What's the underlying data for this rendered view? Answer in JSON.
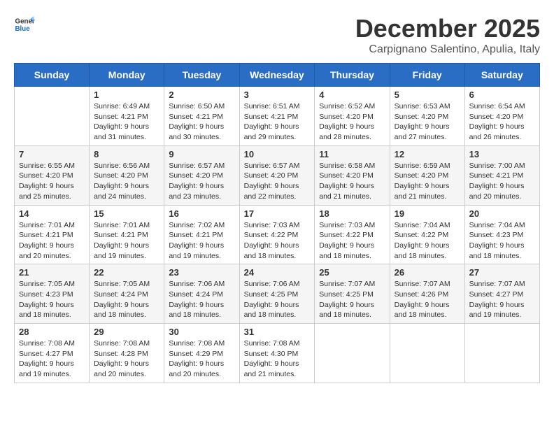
{
  "header": {
    "logo": {
      "general": "General",
      "blue": "Blue"
    },
    "title": "December 2025",
    "location": "Carpignano Salentino, Apulia, Italy"
  },
  "weekdays": [
    "Sunday",
    "Monday",
    "Tuesday",
    "Wednesday",
    "Thursday",
    "Friday",
    "Saturday"
  ],
  "weeks": [
    [
      {
        "day": "",
        "sunrise": "",
        "sunset": "",
        "daylight": ""
      },
      {
        "day": "1",
        "sunrise": "Sunrise: 6:49 AM",
        "sunset": "Sunset: 4:21 PM",
        "daylight": "Daylight: 9 hours and 31 minutes."
      },
      {
        "day": "2",
        "sunrise": "Sunrise: 6:50 AM",
        "sunset": "Sunset: 4:21 PM",
        "daylight": "Daylight: 9 hours and 30 minutes."
      },
      {
        "day": "3",
        "sunrise": "Sunrise: 6:51 AM",
        "sunset": "Sunset: 4:21 PM",
        "daylight": "Daylight: 9 hours and 29 minutes."
      },
      {
        "day": "4",
        "sunrise": "Sunrise: 6:52 AM",
        "sunset": "Sunset: 4:20 PM",
        "daylight": "Daylight: 9 hours and 28 minutes."
      },
      {
        "day": "5",
        "sunrise": "Sunrise: 6:53 AM",
        "sunset": "Sunset: 4:20 PM",
        "daylight": "Daylight: 9 hours and 27 minutes."
      },
      {
        "day": "6",
        "sunrise": "Sunrise: 6:54 AM",
        "sunset": "Sunset: 4:20 PM",
        "daylight": "Daylight: 9 hours and 26 minutes."
      }
    ],
    [
      {
        "day": "7",
        "sunrise": "Sunrise: 6:55 AM",
        "sunset": "Sunset: 4:20 PM",
        "daylight": "Daylight: 9 hours and 25 minutes."
      },
      {
        "day": "8",
        "sunrise": "Sunrise: 6:56 AM",
        "sunset": "Sunset: 4:20 PM",
        "daylight": "Daylight: 9 hours and 24 minutes."
      },
      {
        "day": "9",
        "sunrise": "Sunrise: 6:57 AM",
        "sunset": "Sunset: 4:20 PM",
        "daylight": "Daylight: 9 hours and 23 minutes."
      },
      {
        "day": "10",
        "sunrise": "Sunrise: 6:57 AM",
        "sunset": "Sunset: 4:20 PM",
        "daylight": "Daylight: 9 hours and 22 minutes."
      },
      {
        "day": "11",
        "sunrise": "Sunrise: 6:58 AM",
        "sunset": "Sunset: 4:20 PM",
        "daylight": "Daylight: 9 hours and 21 minutes."
      },
      {
        "day": "12",
        "sunrise": "Sunrise: 6:59 AM",
        "sunset": "Sunset: 4:20 PM",
        "daylight": "Daylight: 9 hours and 21 minutes."
      },
      {
        "day": "13",
        "sunrise": "Sunrise: 7:00 AM",
        "sunset": "Sunset: 4:21 PM",
        "daylight": "Daylight: 9 hours and 20 minutes."
      }
    ],
    [
      {
        "day": "14",
        "sunrise": "Sunrise: 7:01 AM",
        "sunset": "Sunset: 4:21 PM",
        "daylight": "Daylight: 9 hours and 20 minutes."
      },
      {
        "day": "15",
        "sunrise": "Sunrise: 7:01 AM",
        "sunset": "Sunset: 4:21 PM",
        "daylight": "Daylight: 9 hours and 19 minutes."
      },
      {
        "day": "16",
        "sunrise": "Sunrise: 7:02 AM",
        "sunset": "Sunset: 4:21 PM",
        "daylight": "Daylight: 9 hours and 19 minutes."
      },
      {
        "day": "17",
        "sunrise": "Sunrise: 7:03 AM",
        "sunset": "Sunset: 4:22 PM",
        "daylight": "Daylight: 9 hours and 18 minutes."
      },
      {
        "day": "18",
        "sunrise": "Sunrise: 7:03 AM",
        "sunset": "Sunset: 4:22 PM",
        "daylight": "Daylight: 9 hours and 18 minutes."
      },
      {
        "day": "19",
        "sunrise": "Sunrise: 7:04 AM",
        "sunset": "Sunset: 4:22 PM",
        "daylight": "Daylight: 9 hours and 18 minutes."
      },
      {
        "day": "20",
        "sunrise": "Sunrise: 7:04 AM",
        "sunset": "Sunset: 4:23 PM",
        "daylight": "Daylight: 9 hours and 18 minutes."
      }
    ],
    [
      {
        "day": "21",
        "sunrise": "Sunrise: 7:05 AM",
        "sunset": "Sunset: 4:23 PM",
        "daylight": "Daylight: 9 hours and 18 minutes."
      },
      {
        "day": "22",
        "sunrise": "Sunrise: 7:05 AM",
        "sunset": "Sunset: 4:24 PM",
        "daylight": "Daylight: 9 hours and 18 minutes."
      },
      {
        "day": "23",
        "sunrise": "Sunrise: 7:06 AM",
        "sunset": "Sunset: 4:24 PM",
        "daylight": "Daylight: 9 hours and 18 minutes."
      },
      {
        "day": "24",
        "sunrise": "Sunrise: 7:06 AM",
        "sunset": "Sunset: 4:25 PM",
        "daylight": "Daylight: 9 hours and 18 minutes."
      },
      {
        "day": "25",
        "sunrise": "Sunrise: 7:07 AM",
        "sunset": "Sunset: 4:25 PM",
        "daylight": "Daylight: 9 hours and 18 minutes."
      },
      {
        "day": "26",
        "sunrise": "Sunrise: 7:07 AM",
        "sunset": "Sunset: 4:26 PM",
        "daylight": "Daylight: 9 hours and 18 minutes."
      },
      {
        "day": "27",
        "sunrise": "Sunrise: 7:07 AM",
        "sunset": "Sunset: 4:27 PM",
        "daylight": "Daylight: 9 hours and 19 minutes."
      }
    ],
    [
      {
        "day": "28",
        "sunrise": "Sunrise: 7:08 AM",
        "sunset": "Sunset: 4:27 PM",
        "daylight": "Daylight: 9 hours and 19 minutes."
      },
      {
        "day": "29",
        "sunrise": "Sunrise: 7:08 AM",
        "sunset": "Sunset: 4:28 PM",
        "daylight": "Daylight: 9 hours and 20 minutes."
      },
      {
        "day": "30",
        "sunrise": "Sunrise: 7:08 AM",
        "sunset": "Sunset: 4:29 PM",
        "daylight": "Daylight: 9 hours and 20 minutes."
      },
      {
        "day": "31",
        "sunrise": "Sunrise: 7:08 AM",
        "sunset": "Sunset: 4:30 PM",
        "daylight": "Daylight: 9 hours and 21 minutes."
      },
      {
        "day": "",
        "sunrise": "",
        "sunset": "",
        "daylight": ""
      },
      {
        "day": "",
        "sunrise": "",
        "sunset": "",
        "daylight": ""
      },
      {
        "day": "",
        "sunrise": "",
        "sunset": "",
        "daylight": ""
      }
    ]
  ]
}
